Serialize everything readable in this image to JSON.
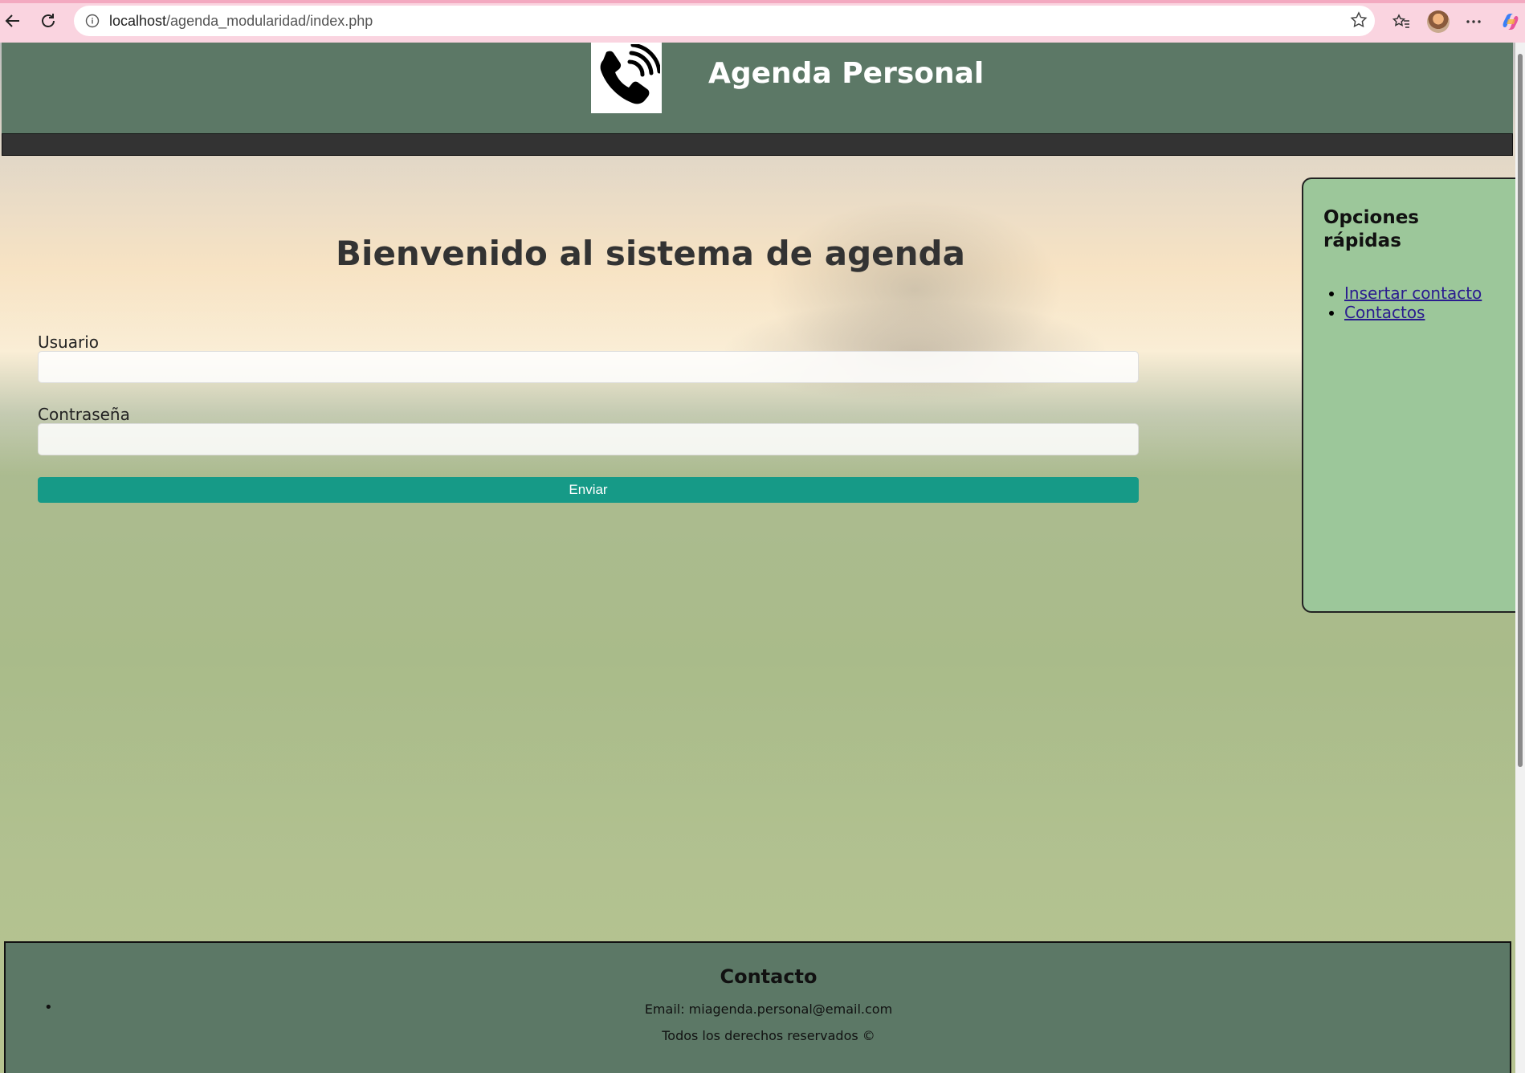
{
  "browser": {
    "url_host": "localhost",
    "url_path": "/agenda_modularidad/index.php"
  },
  "header": {
    "title": "Agenda Personal",
    "logo_icon": "phone-ringing-icon",
    "background_color": "#5c7866",
    "nav_strip_color": "#333333"
  },
  "main": {
    "welcome": "Bienvenido al sistema de agenda",
    "username_label": "Usuario",
    "username_value": "",
    "password_label": "Contraseña",
    "password_value": "",
    "submit_label": "Enviar",
    "submit_color": "#169a87"
  },
  "sidebar": {
    "title": "Opciones rápidas",
    "links": [
      {
        "label": "Insertar contacto"
      },
      {
        "label": "Contactos"
      }
    ],
    "background_color": "#9cc79a"
  },
  "footer": {
    "title": "Contacto",
    "email": "Email: miagenda.personal@email.com",
    "rights": "Todos los derechos reservados ©"
  }
}
